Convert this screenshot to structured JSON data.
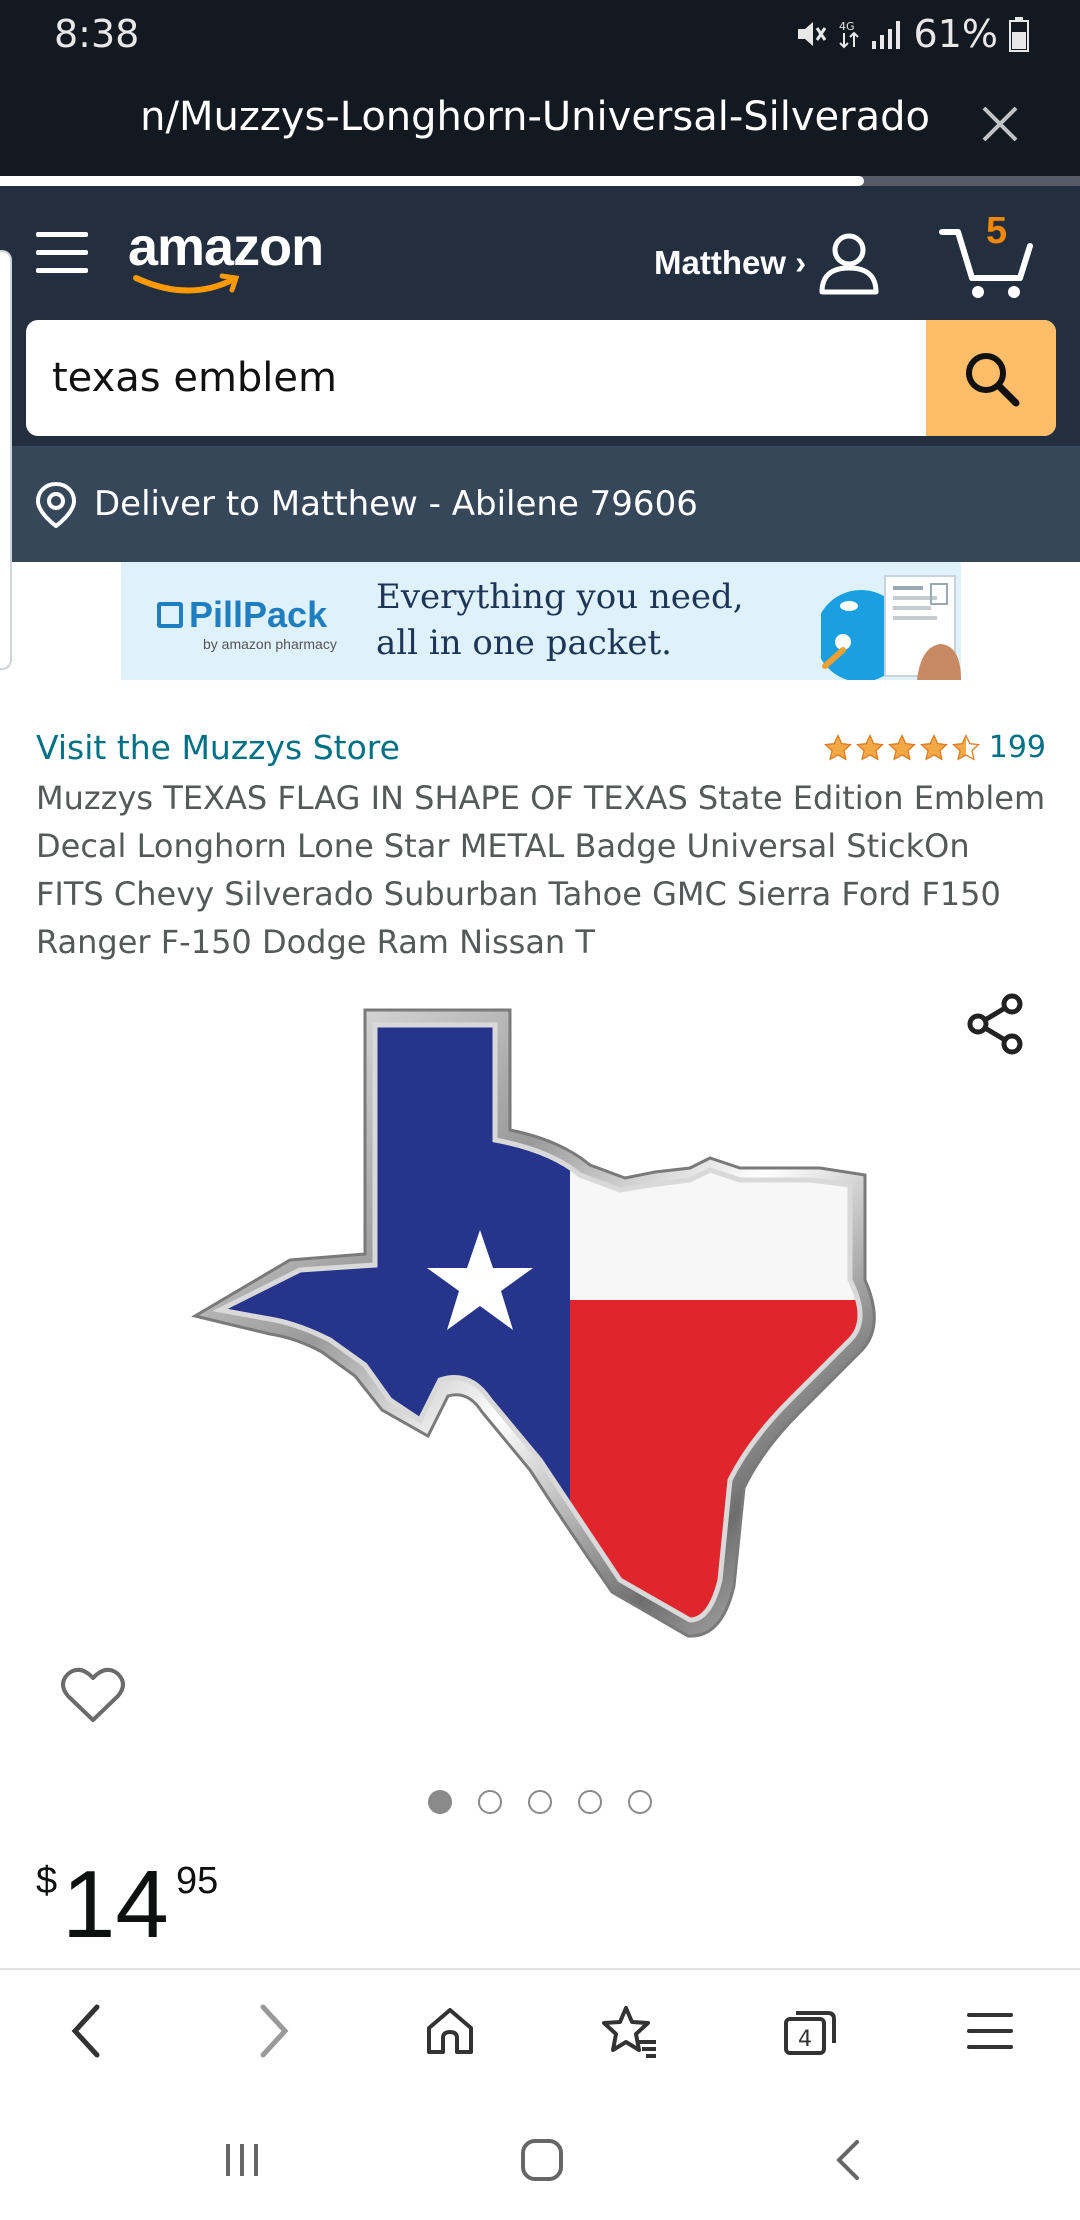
{
  "status_bar": {
    "time": "8:38",
    "battery": "61%"
  },
  "browser": {
    "url_text": "n/Muzzys-Longhorn-Universal-Silverado-",
    "load_progress": 0.8,
    "tab_count": "4"
  },
  "header": {
    "logo_text": "amazon",
    "account_name": "Matthew ›",
    "cart_count": "5"
  },
  "search": {
    "value": "texas emblem"
  },
  "delivery": {
    "text": "Deliver to Matthew - Abilene 79606"
  },
  "ad": {
    "brand": "PillPack",
    "brand_sub": "by amazon pharmacy",
    "line1": "Everything you need,",
    "line2": "all in one packet."
  },
  "product": {
    "store_link": "Visit the Muzzys Store",
    "rating_stars": 4.5,
    "rating_count": "199",
    "title": "Muzzys TEXAS FLAG IN SHAPE OF TEXAS State Edition Emblem Decal Longhorn Lone Star METAL Badge Universal StickOn FITS Chevy Silverado Suburban Tahoe GMC Sierra Ford F150 Ranger F-150 Dodge Ram Nissan T",
    "image_count": 5,
    "active_image": 1,
    "price_symbol": "$",
    "price_whole": "14",
    "price_fraction": "95"
  },
  "colors": {
    "header_dark": "#131921",
    "header": "#232f3e",
    "deliver_bar": "#37475a",
    "search_button": "#febd69",
    "link": "#007185",
    "star": "#f3a847",
    "cart_count": "#f08804"
  },
  "icons": [
    "mute-icon",
    "signal-icon",
    "battery-icon",
    "close-icon",
    "hamburger-icon",
    "account-icon",
    "cart-icon",
    "search-icon",
    "location-icon",
    "share-icon",
    "heart-icon",
    "back-icon",
    "forward-icon",
    "home-icon",
    "bookmark-icon",
    "tabs-icon",
    "menu-icon"
  ]
}
